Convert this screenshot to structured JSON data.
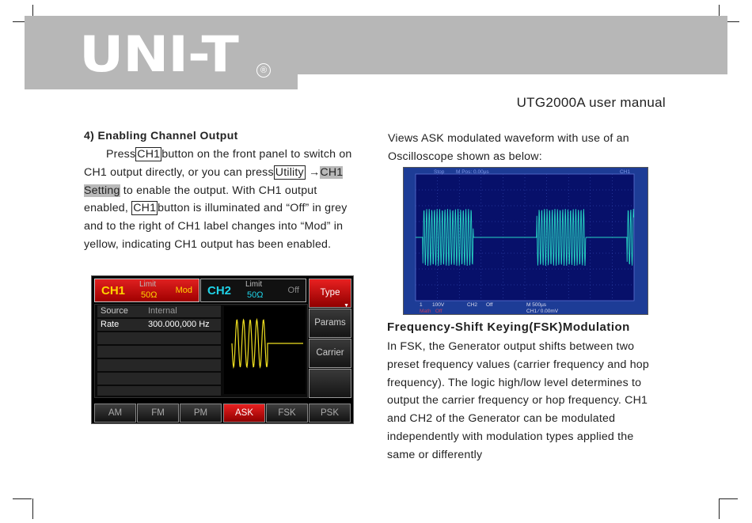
{
  "header": {
    "logo": "UNI-T",
    "registered_mark": "®",
    "manual_title": "UTG2000A user manual"
  },
  "left": {
    "heading": "4) Enabling Channel Output",
    "p1_l1_a": "Press",
    "p1_l1_btn": "CH1",
    "p1_l1_b": "button on the front panel to switch on",
    "p1_l2_a": "CH1 output directly, or you can press",
    "p1_l2_btn": "Utility",
    "p1_l2_arrow": " →",
    "p1_l2_hl": "CH1",
    "p1_l3_hl": "Setting",
    "p1_l3_b": " to enable the output. With CH1 output",
    "p1_l4_a": "enabled, ",
    "p1_l4_btn": "CH1",
    "p1_l4_b": "button is illuminated and “Off” in grey",
    "p1_l5": " and to the right of CH1 label changes into “Mod” in",
    "p1_l6": "yellow, indicating CH1 output has been enabled."
  },
  "device": {
    "ch1": {
      "name": "CH1",
      "limit_label": "Limit",
      "impedance": "50Ω",
      "state": "Mod"
    },
    "ch2": {
      "name": "CH2",
      "limit_label": "Limit",
      "impedance": "50Ω",
      "state": "Off"
    },
    "params": [
      {
        "label": "Source",
        "value": "Internal"
      },
      {
        "label": "Rate",
        "value": "300.000,000 Hz"
      }
    ],
    "softkeys": [
      "Type",
      "Params",
      "Carrier",
      ""
    ],
    "more_indicator": "▼",
    "tabs": [
      "AM",
      "FM",
      "PM",
      "ASK",
      "FSK",
      "PSK"
    ],
    "active_tab": "ASK",
    "colors": {
      "ch1": "#ffd400",
      "ch2": "#1fd3e8",
      "active": "#d01010",
      "wave": "#f0e020"
    }
  },
  "right": {
    "p1_l1": "    Views ASK modulated waveform with use of an",
    "p1_l2": "Oscilloscope shown as below:",
    "scope": {
      "top_stop": "Stop",
      "top_mpos": "M Pos: 0.00µs",
      "top_ch": "CH1",
      "ch1_scale": "100V",
      "ch2_label": "CH2",
      "ch2_state": "Off",
      "time_scale": "M 500µs",
      "math_label": "Math",
      "math_state": "Off",
      "trigger": "CH1 ∕ 0.00mV",
      "ch1_marker": "1",
      "trace_color": "#27d6c4"
    },
    "fsk_heading": "Frequency-Shift Keying(FSK)Modulation",
    "p2_l1": "   In FSK, the Generator output shifts between two",
    "p2_l2": "preset frequency values (carrier frequency and hop",
    "p2_l3": "frequency). The logic high/low level determines to",
    "p2_l4": "output the carrier frequency or hop frequency. CH1",
    "p2_l5": "and CH2 of the Generator can be modulated",
    "p2_l6": "independently with modulation types applied the",
    "p2_l7": " same or differently"
  }
}
